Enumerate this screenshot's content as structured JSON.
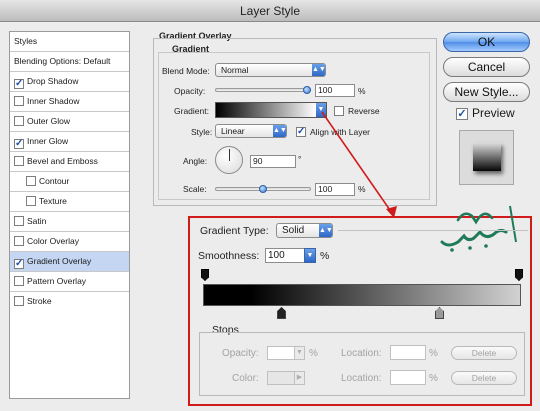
{
  "window": {
    "title": "Layer Style"
  },
  "styles_list": {
    "header": "Styles",
    "items": [
      {
        "label": "Blending Options: Default",
        "checkbox": false,
        "checked": false,
        "indent": false,
        "selected": false
      },
      {
        "label": "Drop Shadow",
        "checkbox": true,
        "checked": true,
        "indent": false,
        "selected": false
      },
      {
        "label": "Inner Shadow",
        "checkbox": true,
        "checked": false,
        "indent": false,
        "selected": false
      },
      {
        "label": "Outer Glow",
        "checkbox": true,
        "checked": false,
        "indent": false,
        "selected": false
      },
      {
        "label": "Inner Glow",
        "checkbox": true,
        "checked": true,
        "indent": false,
        "selected": false
      },
      {
        "label": "Bevel and Emboss",
        "checkbox": true,
        "checked": false,
        "indent": false,
        "selected": false
      },
      {
        "label": "Contour",
        "checkbox": true,
        "checked": false,
        "indent": true,
        "selected": false
      },
      {
        "label": "Texture",
        "checkbox": true,
        "checked": false,
        "indent": true,
        "selected": false
      },
      {
        "label": "Satin",
        "checkbox": true,
        "checked": false,
        "indent": false,
        "selected": false
      },
      {
        "label": "Color Overlay",
        "checkbox": true,
        "checked": false,
        "indent": false,
        "selected": false
      },
      {
        "label": "Gradient Overlay",
        "checkbox": true,
        "checked": true,
        "indent": false,
        "selected": true
      },
      {
        "label": "Pattern Overlay",
        "checkbox": true,
        "checked": false,
        "indent": false,
        "selected": false
      },
      {
        "label": "Stroke",
        "checkbox": true,
        "checked": false,
        "indent": false,
        "selected": false
      }
    ]
  },
  "gradient_overlay": {
    "group_title": "Gradient Overlay",
    "subgroup_title": "Gradient",
    "blend_mode_label": "Blend Mode:",
    "blend_mode_value": "Normal",
    "opacity_label": "Opacity:",
    "opacity_value": "100",
    "opacity_unit": "%",
    "opacity_level": 1.0,
    "gradient_label": "Gradient:",
    "reverse_label": "Reverse",
    "style_label": "Style:",
    "style_value": "Linear",
    "align_label": "Align with Layer",
    "angle_label": "Angle:",
    "angle_value": "90",
    "angle_unit": "°",
    "scale_label": "Scale:",
    "scale_value": "100",
    "scale_unit": "%",
    "scale_level": 0.5
  },
  "buttons": {
    "ok": "OK",
    "cancel": "Cancel",
    "new_style": "New Style...",
    "preview_label": "Preview"
  },
  "gradient_editor": {
    "type_label": "Gradient Type:",
    "type_value": "Solid",
    "smoothness_label": "Smoothness:",
    "smoothness_value": "100",
    "smoothness_unit": "%",
    "stops_title": "Stops",
    "opacity_label": "Opacity:",
    "opacity_unit": "%",
    "location_label": "Location:",
    "location_unit": "%",
    "delete_label": "Delete",
    "color_label": "Color:",
    "location2_label": "Location:",
    "location2_unit": "%",
    "delete2_label": "Delete"
  },
  "colors": {
    "callout_red": "#d11a1a",
    "accent_blue": "#3d7ad9",
    "selection": "#c4d6f2"
  }
}
